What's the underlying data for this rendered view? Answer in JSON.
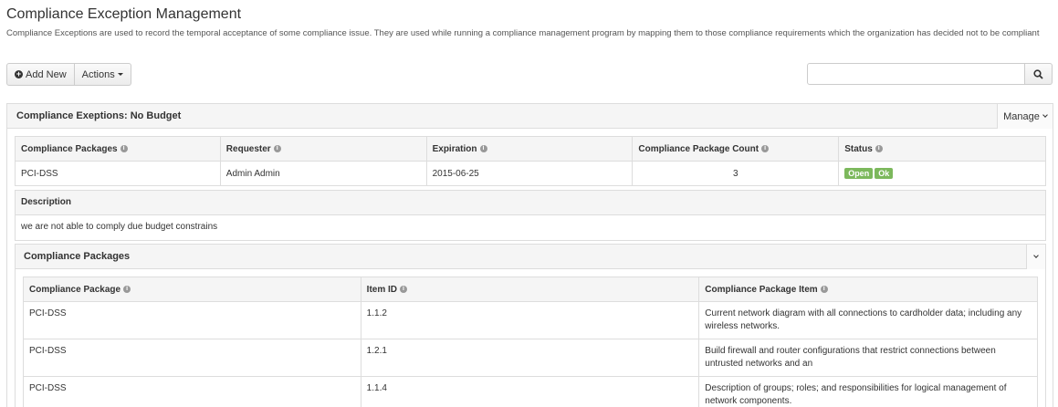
{
  "page": {
    "title": "Compliance Exception Management",
    "description": "Compliance Exceptions are used to record the temporal acceptance of some compliance issue. They are used while running a compliance management program by mapping them to those compliance requirements which the organization has decided not to be compliant"
  },
  "toolbar": {
    "add_label": "Add New",
    "actions_label": "Actions",
    "search_value": ""
  },
  "panel": {
    "title": "Compliance Exeptions: No Budget",
    "manage_label": "Manage",
    "columns": [
      "Compliance Packages",
      "Requester",
      "Expiration",
      "Compliance Package Count",
      "Status"
    ],
    "row": {
      "compliance_packages": "PCI-DSS",
      "requester": "Admin Admin",
      "expiration": "2015-06-25",
      "count": "3",
      "status": [
        "Open",
        "Ok"
      ]
    },
    "description_label": "Description",
    "description_text": "we are not able to comply due budget constrains",
    "accent_color": "#7cb85c"
  },
  "packages": {
    "title": "Compliance Packages",
    "columns": [
      "Compliance Package",
      "Item ID",
      "Compliance Package Item"
    ],
    "rows": [
      {
        "package": "PCI-DSS",
        "item_id": "1.1.2",
        "item": "Current network diagram with all connections to cardholder data; including any wireless networks."
      },
      {
        "package": "PCI-DSS",
        "item_id": "1.2.1",
        "item": "Build firewall and router configurations that restrict connections between untrusted networks and an"
      },
      {
        "package": "PCI-DSS",
        "item_id": "1.1.4",
        "item": "Description of groups; roles; and responsibilities for logical management of network components."
      }
    ]
  },
  "icons": {
    "add": "plus-circle-icon",
    "search": "search-icon",
    "info": "info-icon",
    "caret": "caret-down-icon",
    "chevron": "chevron-down-icon"
  }
}
